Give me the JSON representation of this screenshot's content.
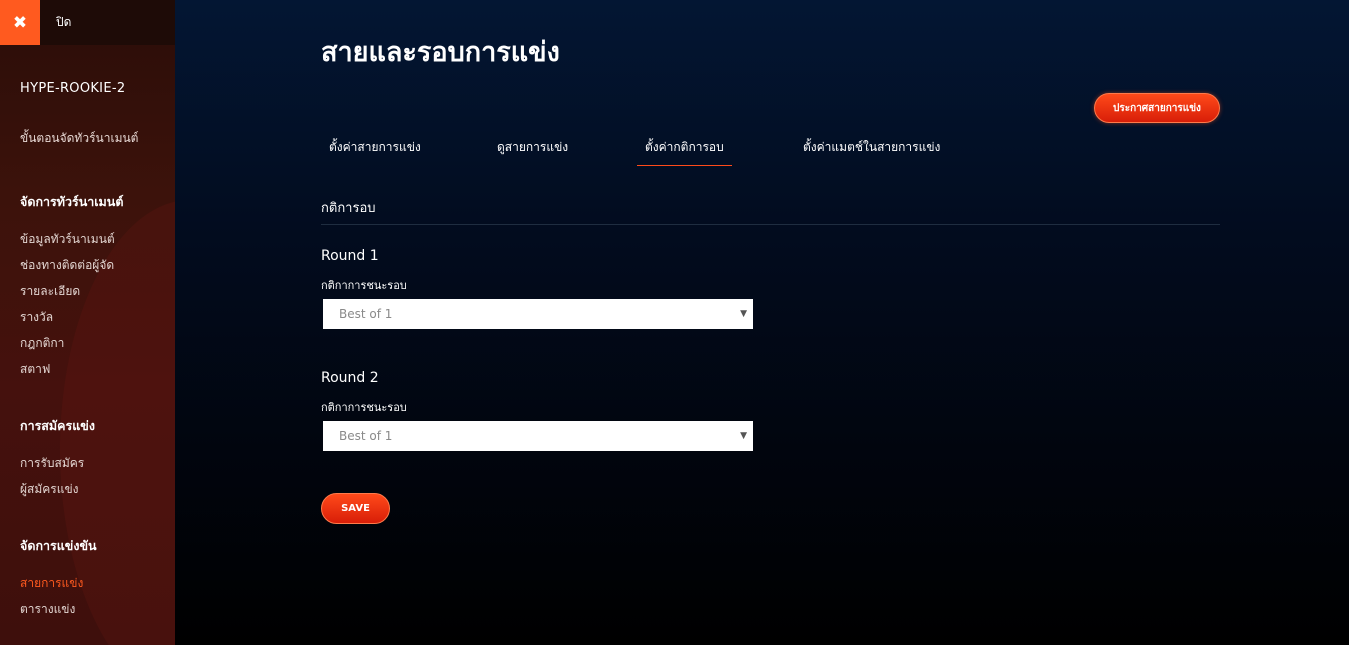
{
  "sidebar": {
    "close_label": "ปิด",
    "tournament_name": "HYPE-ROOKIE-2",
    "steps_label": "ขั้นตอนจัดทัวร์นาเมนต์",
    "sections": [
      {
        "title": "จัดการทัวร์นาเมนต์",
        "items": [
          "ข้อมูลทัวร์นาเมนต์",
          "ช่องทางติดต่อผู้จัด",
          "รายละเอียด",
          "รางวัล",
          "กฎกติกา",
          "สตาฟ"
        ]
      },
      {
        "title": "การสมัครแข่ง",
        "items": [
          "การรับสมัคร",
          "ผู้สมัครแข่ง"
        ]
      },
      {
        "title": "จัดการแข่งขัน",
        "items": [
          "สายการแข่ง",
          "ตารางแข่ง"
        ]
      }
    ],
    "active_item": "สายการแข่ง"
  },
  "main": {
    "title": "สายและรอบการแข่ง",
    "announce_button": "ประกาศสายการแข่ง",
    "tabs": [
      {
        "label": "ตั้งค่าสายการแข่ง"
      },
      {
        "label": "ดูสายการแข่ง"
      },
      {
        "label": "ตั้งค่ากติการอบ"
      },
      {
        "label": "ตั้งค่าแมตช์ในสายการแข่ง"
      }
    ],
    "active_tab": "ตั้งค่ากติการอบ",
    "section_title": "กติการอบ",
    "rounds": [
      {
        "label": "Round 1",
        "field_label": "กติกาการชนะรอบ",
        "value": "Best of 1"
      },
      {
        "label": "Round 2",
        "field_label": "กติกาการชนะรอบ",
        "value": "Best of 1"
      }
    ],
    "save_button": "SAVE"
  },
  "colors": {
    "accent": "#ff5a1f",
    "sidebar_bg": "#3c120b",
    "main_bg": "#031633"
  }
}
